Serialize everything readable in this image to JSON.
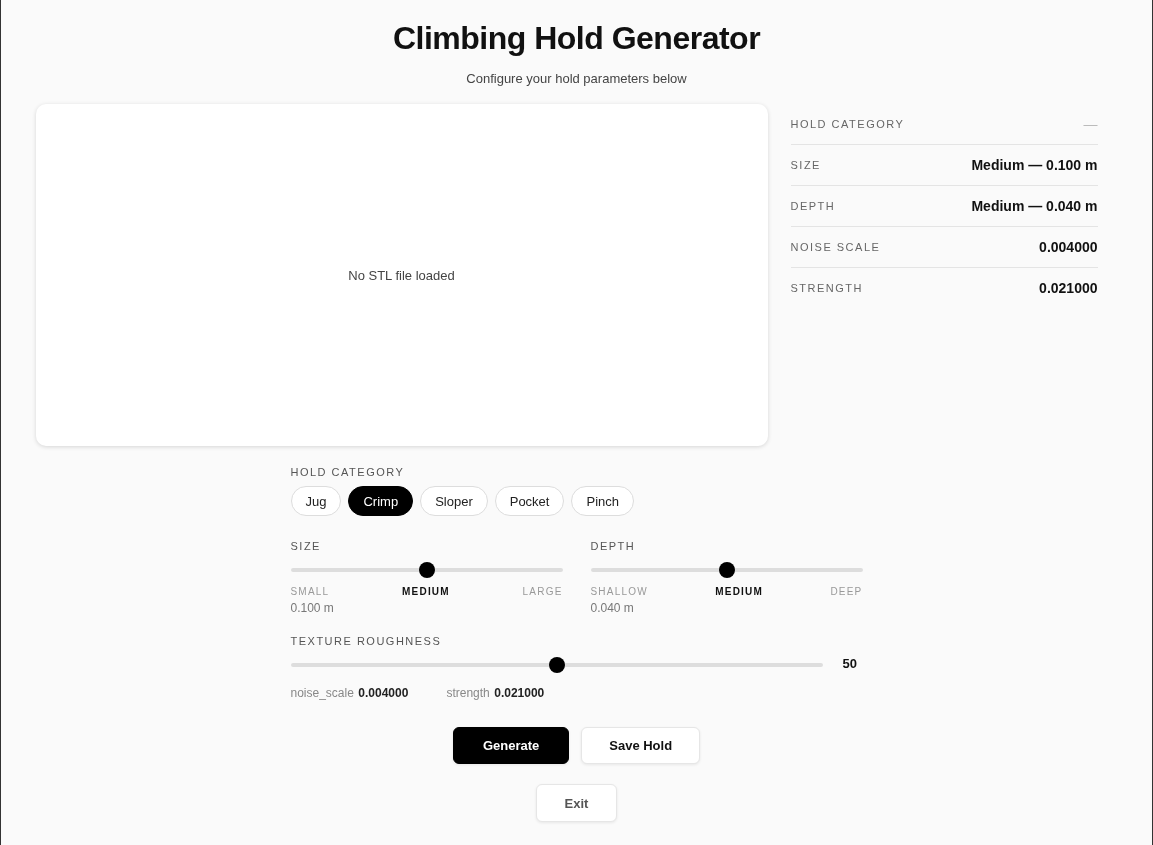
{
  "title": "Climbing Hold Generator",
  "subtitle": "Configure your hold parameters below",
  "viewer": {
    "message": "No STL file loaded"
  },
  "summary": [
    {
      "label": "HOLD CATEGORY",
      "value": "—",
      "muted": true
    },
    {
      "label": "SIZE",
      "value": "Medium — 0.100 m",
      "muted": false
    },
    {
      "label": "DEPTH",
      "value": "Medium — 0.040 m",
      "muted": false
    },
    {
      "label": "NOISE SCALE",
      "value": "0.004000",
      "muted": false
    },
    {
      "label": "STRENGTH",
      "value": "0.021000",
      "muted": false
    }
  ],
  "category": {
    "label": "HOLD CATEGORY",
    "options": [
      {
        "label": "Jug",
        "selected": false
      },
      {
        "label": "Crimp",
        "selected": true
      },
      {
        "label": "Sloper",
        "selected": false
      },
      {
        "label": "Pocket",
        "selected": false
      },
      {
        "label": "Pinch",
        "selected": false
      }
    ]
  },
  "sliders": [
    {
      "label": "SIZE",
      "level": 0.5,
      "ticks": [
        {
          "label": "SMALL",
          "selected": false
        },
        {
          "label": "MEDIUM",
          "selected": true
        },
        {
          "label": "LARGE",
          "selected": false
        }
      ],
      "reading": "0.100 m"
    },
    {
      "label": "DEPTH",
      "level": 0.5,
      "ticks": [
        {
          "label": "SHALLOW",
          "selected": false
        },
        {
          "label": "MEDIUM",
          "selected": true
        },
        {
          "label": "DEEP",
          "selected": false
        }
      ],
      "reading": "0.040 m"
    }
  ],
  "roughness": {
    "label": "TEXTURE ROUGHNESS",
    "level": 0.5,
    "reading": "50",
    "params": [
      {
        "name": "noise_scale",
        "value": "0.004000"
      },
      {
        "name": "strength",
        "value": "0.021000"
      }
    ]
  },
  "buttons": [
    {
      "label": "Generate",
      "kind": "primary"
    },
    {
      "label": "Save Hold",
      "kind": "secondary"
    }
  ],
  "exit": {
    "label": "Exit"
  }
}
